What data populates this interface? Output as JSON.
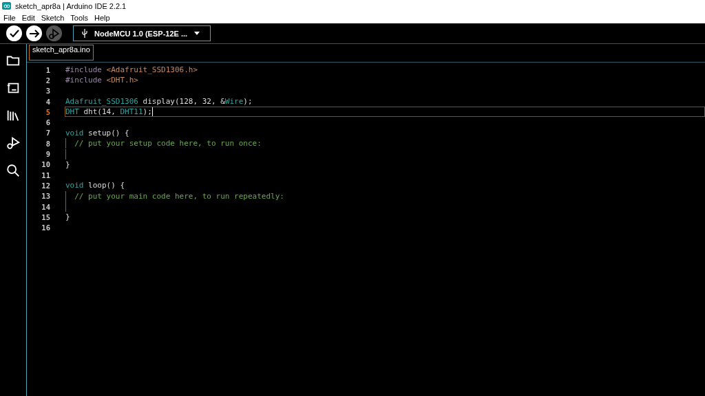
{
  "window": {
    "title": "sketch_apr8a | Arduino IDE 2.2.1"
  },
  "menu": [
    "File",
    "Edit",
    "Sketch",
    "Tools",
    "Help"
  ],
  "toolbar": {
    "buttons": [
      {
        "kind": "verify",
        "disabled": false
      },
      {
        "kind": "upload",
        "disabled": false
      },
      {
        "kind": "debug",
        "disabled": true
      }
    ],
    "board": "NodeMCU 1.0 (ESP-12E ..."
  },
  "sidebar": [
    {
      "kind": "folder"
    },
    {
      "kind": "board"
    },
    {
      "kind": "library"
    },
    {
      "kind": "debug"
    },
    {
      "kind": "search"
    }
  ],
  "tabs": [
    {
      "label": "sketch_apr8a.ino",
      "selected": true
    }
  ],
  "editor": {
    "lines": [
      {
        "number": "1",
        "current": false,
        "tokens": [
          {
            "text": "#include",
            "kind": "directive"
          },
          {
            "text": " <Adafruit_SSD1306.h>",
            "kind": "string"
          }
        ]
      },
      {
        "number": "2",
        "current": false,
        "tokens": [
          {
            "text": "#include",
            "kind": "directive"
          },
          {
            "text": " <DHT.h>",
            "kind": "string"
          }
        ]
      },
      {
        "number": "3",
        "current": false
      },
      {
        "number": "4",
        "current": false,
        "tokens": [
          {
            "text": "Adafruit_SSD1306",
            "kind": "type"
          },
          {
            "text": " display(128, 32, &",
            "kind": "plain"
          },
          {
            "text": "Wire",
            "kind": "type"
          },
          {
            "text": ");",
            "kind": "plain"
          }
        ]
      },
      {
        "number": "5",
        "current": true,
        "tokens": [
          {
            "text": "DHT",
            "kind": "type"
          },
          {
            "text": " dht(14, ",
            "kind": "plain"
          },
          {
            "text": "DHT11",
            "kind": "type"
          },
          {
            "text": ");",
            "kind": "plain"
          }
        ]
      },
      {
        "number": "6",
        "current": false
      },
      {
        "number": "7",
        "current": false,
        "tokens": [
          {
            "text": "void",
            "kind": "keyword"
          },
          {
            "text": " setup() {",
            "kind": "plain"
          }
        ]
      },
      {
        "number": "8",
        "current": false,
        "guide": true,
        "tokens": [
          {
            "text": "  // put your setup code here, to run once:",
            "kind": "comment"
          }
        ]
      },
      {
        "number": "9",
        "current": false,
        "guide": true
      },
      {
        "number": "10",
        "current": false,
        "tokens": [
          {
            "text": "}",
            "kind": "plain"
          }
        ]
      },
      {
        "number": "11",
        "current": false
      },
      {
        "number": "12",
        "current": false,
        "tokens": [
          {
            "text": "void",
            "kind": "keyword"
          },
          {
            "text": " loop() {",
            "kind": "plain"
          }
        ]
      },
      {
        "number": "13",
        "current": false,
        "guide": true,
        "tokens": [
          {
            "text": "  // put your main code here, to run repeatedly:",
            "kind": "comment"
          }
        ]
      },
      {
        "number": "14",
        "current": false,
        "guide": true
      },
      {
        "number": "15",
        "current": false,
        "tokens": [
          {
            "text": "}",
            "kind": "plain"
          }
        ]
      },
      {
        "number": "16",
        "current": false
      }
    ]
  }
}
